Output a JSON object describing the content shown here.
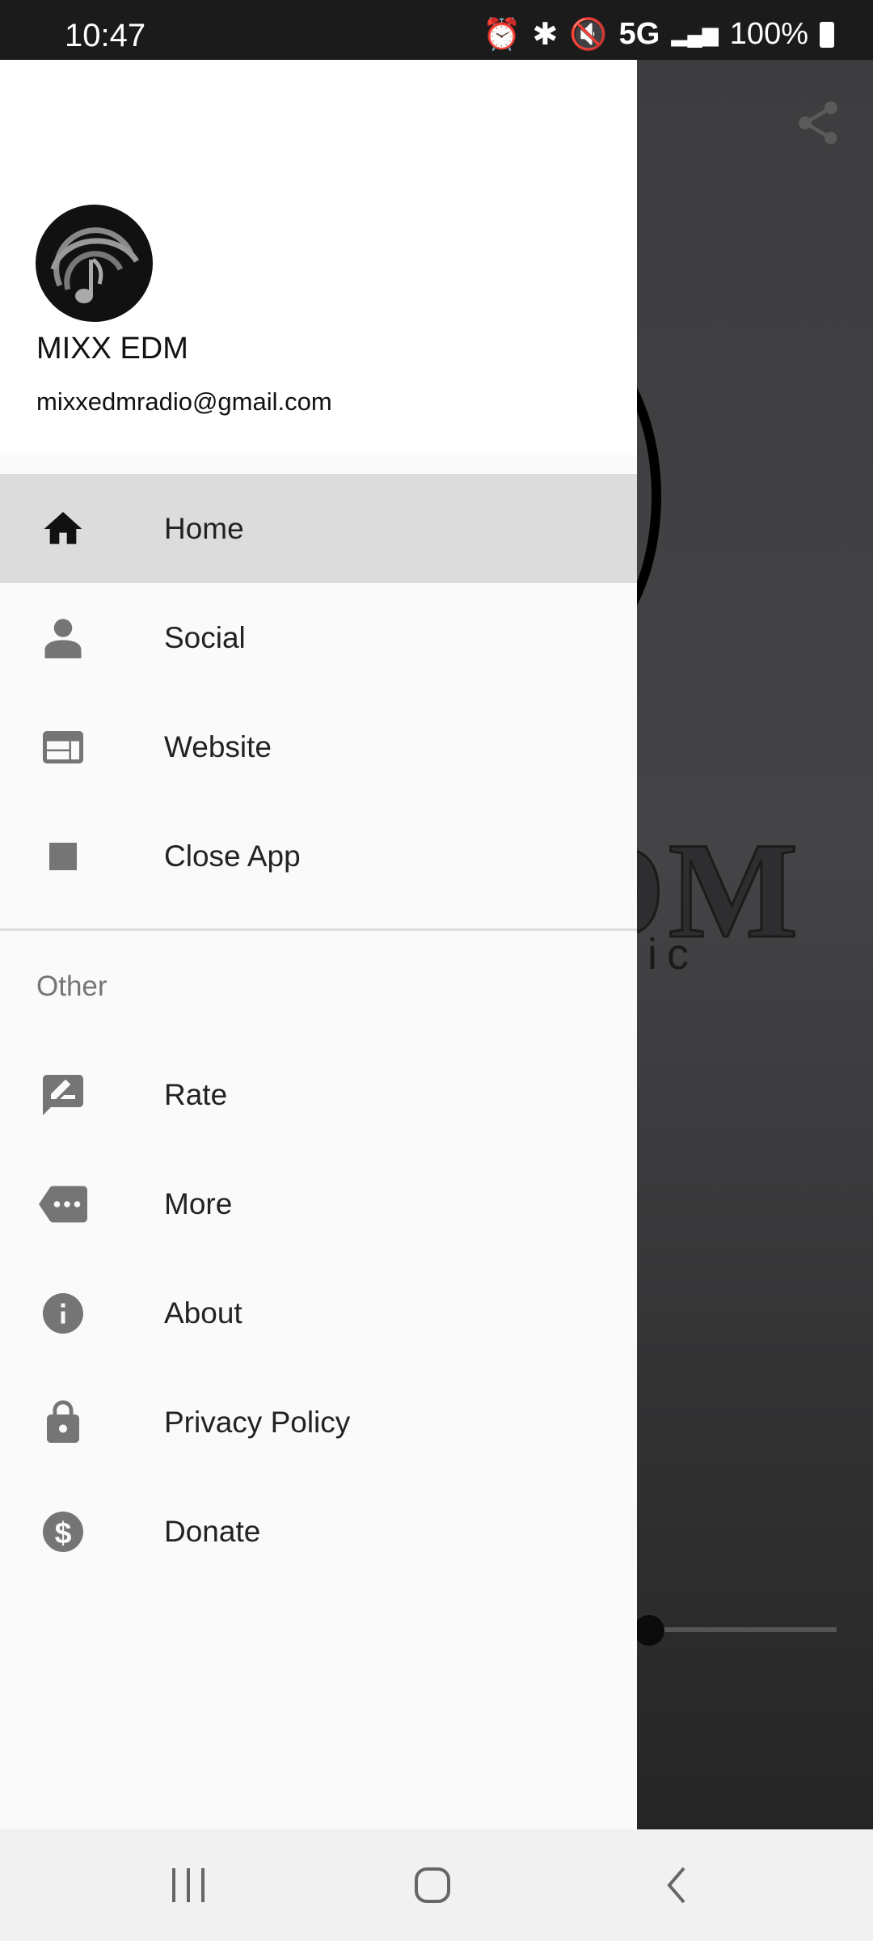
{
  "status_bar": {
    "time": "10:47",
    "network": "5G",
    "battery": "100%"
  },
  "drawer": {
    "header": {
      "title": "MIXX EDM",
      "email": "mixxedmradio@gmail.com"
    },
    "items": [
      {
        "label": "Home",
        "icon": "home-icon",
        "selected": true
      },
      {
        "label": "Social",
        "icon": "person-icon"
      },
      {
        "label": "Website",
        "icon": "web-icon"
      },
      {
        "label": "Close App",
        "icon": "stop-icon"
      }
    ],
    "section_label": "Other",
    "other_items": [
      {
        "label": "Rate",
        "icon": "rate-review-icon"
      },
      {
        "label": "More",
        "icon": "more-tag-icon"
      },
      {
        "label": "About",
        "icon": "info-icon"
      },
      {
        "label": "Privacy Policy",
        "icon": "lock-icon"
      },
      {
        "label": "Donate",
        "icon": "dollar-icon"
      }
    ]
  },
  "background": {
    "logo_text": "DM",
    "logo_sub": "usic",
    "volume_level": 0
  },
  "colors": {
    "icon": "#757575",
    "selected_bg": "#dcdcdc",
    "status_bar": "#1b1b1b"
  }
}
